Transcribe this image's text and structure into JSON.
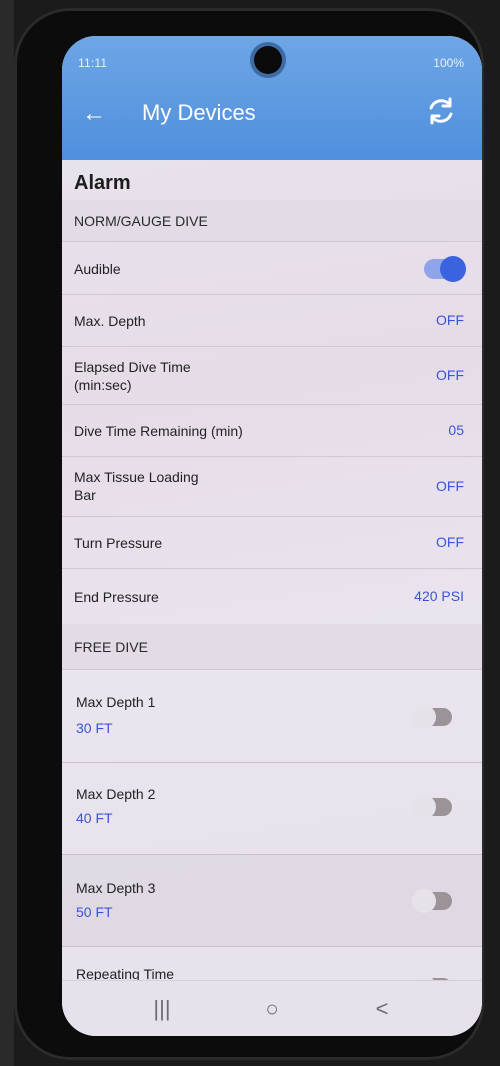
{
  "status_bar": {
    "time": "11:11",
    "battery": "100%"
  },
  "header": {
    "title": "My Devices",
    "back_icon": "arrow-left-icon",
    "refresh_icon": "refresh-icon"
  },
  "alarm": {
    "title": "Alarm",
    "norm_section_label": "NORM/GAUGE DIVE",
    "audible": {
      "label": "Audible",
      "enabled": true
    },
    "rows": [
      {
        "label": "Max. Depth",
        "value": "OFF"
      },
      {
        "label_line1": "Elapsed Dive Time",
        "label_line2": "(min:sec)",
        "value": "OFF"
      },
      {
        "label": "Dive Time Remaining (min)",
        "value": "05"
      },
      {
        "label_line1": "Max Tissue Loading",
        "label_line2": "Bar",
        "value": "OFF"
      },
      {
        "label": "Turn Pressure",
        "value": "OFF"
      },
      {
        "label": "End Pressure",
        "value": "420 PSI"
      }
    ],
    "free_section_label": "FREE DIVE",
    "free_rows": [
      {
        "label": "Max Depth 1",
        "value": "30 FT",
        "enabled": false
      },
      {
        "label": "Max Depth 2",
        "value": "40 FT",
        "enabled": false
      },
      {
        "label": "Max Depth 3",
        "value": "50 FT",
        "enabled": false
      },
      {
        "label": "Repeating Time",
        "enabled": false
      }
    ]
  },
  "nav_bar": {
    "recents": "|||",
    "home": "○",
    "back": "<"
  },
  "colors": {
    "app_bar": "#4f8fdd",
    "accent_value": "#3a55d6",
    "toggle_on": "#3b63e0"
  }
}
